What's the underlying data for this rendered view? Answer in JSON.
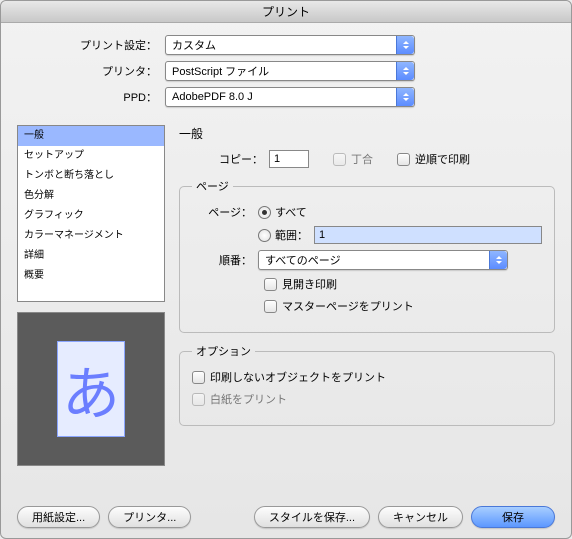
{
  "title": "プリント",
  "top": {
    "preset_label": "プリント設定：",
    "preset_value": "カスタム",
    "printer_label": "プリンタ：",
    "printer_value": "PostScript ファイル",
    "ppd_label": "PPD：",
    "ppd_value": "AdobePDF 8.0 J"
  },
  "sidebar": {
    "items": [
      "一般",
      "セットアップ",
      "トンボと断ち落とし",
      "色分解",
      "グラフィック",
      "カラーマネージメント",
      "詳細",
      "概要"
    ],
    "selected_index": 0
  },
  "general": {
    "heading": "一般",
    "copies_label": "コピー：",
    "copies_value": "1",
    "collate_label": "丁合",
    "reverse_label": "逆順で印刷",
    "pages_group_title": "ページ",
    "pages_label": "ページ：",
    "all_label": "すべて",
    "range_label": "範囲：",
    "range_value": "1",
    "order_label": "順番：",
    "order_value": "すべてのページ",
    "spreads_label": "見開き印刷",
    "master_label": "マスターページをプリント"
  },
  "options": {
    "group_title": "オプション",
    "nonprinting_label": "印刷しないオブジェクトをプリント",
    "blank_label": "白紙をプリント"
  },
  "buttons": {
    "page_setup": "用紙設定...",
    "printer": "プリンタ...",
    "save_style": "スタイルを保存...",
    "cancel": "キャンセル",
    "save": "保存"
  },
  "preview": {
    "glyph": "あ"
  }
}
